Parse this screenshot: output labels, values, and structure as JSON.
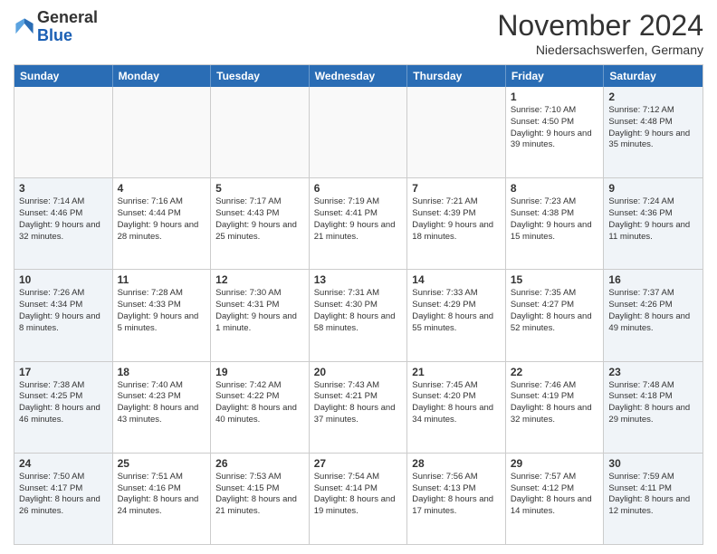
{
  "logo": {
    "line1": "General",
    "line2": "Blue"
  },
  "title": "November 2024",
  "subtitle": "Niedersachswerfen, Germany",
  "header_days": [
    "Sunday",
    "Monday",
    "Tuesday",
    "Wednesday",
    "Thursday",
    "Friday",
    "Saturday"
  ],
  "rows": [
    [
      {
        "day": "",
        "info": "",
        "empty": true
      },
      {
        "day": "",
        "info": "",
        "empty": true
      },
      {
        "day": "",
        "info": "",
        "empty": true
      },
      {
        "day": "",
        "info": "",
        "empty": true
      },
      {
        "day": "",
        "info": "",
        "empty": true
      },
      {
        "day": "1",
        "info": "Sunrise: 7:10 AM\nSunset: 4:50 PM\nDaylight: 9 hours\nand 39 minutes."
      },
      {
        "day": "2",
        "info": "Sunrise: 7:12 AM\nSunset: 4:48 PM\nDaylight: 9 hours\nand 35 minutes.",
        "shaded": true
      }
    ],
    [
      {
        "day": "3",
        "info": "Sunrise: 7:14 AM\nSunset: 4:46 PM\nDaylight: 9 hours\nand 32 minutes.",
        "shaded": true
      },
      {
        "day": "4",
        "info": "Sunrise: 7:16 AM\nSunset: 4:44 PM\nDaylight: 9 hours\nand 28 minutes."
      },
      {
        "day": "5",
        "info": "Sunrise: 7:17 AM\nSunset: 4:43 PM\nDaylight: 9 hours\nand 25 minutes."
      },
      {
        "day": "6",
        "info": "Sunrise: 7:19 AM\nSunset: 4:41 PM\nDaylight: 9 hours\nand 21 minutes."
      },
      {
        "day": "7",
        "info": "Sunrise: 7:21 AM\nSunset: 4:39 PM\nDaylight: 9 hours\nand 18 minutes."
      },
      {
        "day": "8",
        "info": "Sunrise: 7:23 AM\nSunset: 4:38 PM\nDaylight: 9 hours\nand 15 minutes."
      },
      {
        "day": "9",
        "info": "Sunrise: 7:24 AM\nSunset: 4:36 PM\nDaylight: 9 hours\nand 11 minutes.",
        "shaded": true
      }
    ],
    [
      {
        "day": "10",
        "info": "Sunrise: 7:26 AM\nSunset: 4:34 PM\nDaylight: 9 hours\nand 8 minutes.",
        "shaded": true
      },
      {
        "day": "11",
        "info": "Sunrise: 7:28 AM\nSunset: 4:33 PM\nDaylight: 9 hours\nand 5 minutes."
      },
      {
        "day": "12",
        "info": "Sunrise: 7:30 AM\nSunset: 4:31 PM\nDaylight: 9 hours\nand 1 minute."
      },
      {
        "day": "13",
        "info": "Sunrise: 7:31 AM\nSunset: 4:30 PM\nDaylight: 8 hours\nand 58 minutes."
      },
      {
        "day": "14",
        "info": "Sunrise: 7:33 AM\nSunset: 4:29 PM\nDaylight: 8 hours\nand 55 minutes."
      },
      {
        "day": "15",
        "info": "Sunrise: 7:35 AM\nSunset: 4:27 PM\nDaylight: 8 hours\nand 52 minutes."
      },
      {
        "day": "16",
        "info": "Sunrise: 7:37 AM\nSunset: 4:26 PM\nDaylight: 8 hours\nand 49 minutes.",
        "shaded": true
      }
    ],
    [
      {
        "day": "17",
        "info": "Sunrise: 7:38 AM\nSunset: 4:25 PM\nDaylight: 8 hours\nand 46 minutes.",
        "shaded": true
      },
      {
        "day": "18",
        "info": "Sunrise: 7:40 AM\nSunset: 4:23 PM\nDaylight: 8 hours\nand 43 minutes."
      },
      {
        "day": "19",
        "info": "Sunrise: 7:42 AM\nSunset: 4:22 PM\nDaylight: 8 hours\nand 40 minutes."
      },
      {
        "day": "20",
        "info": "Sunrise: 7:43 AM\nSunset: 4:21 PM\nDaylight: 8 hours\nand 37 minutes."
      },
      {
        "day": "21",
        "info": "Sunrise: 7:45 AM\nSunset: 4:20 PM\nDaylight: 8 hours\nand 34 minutes."
      },
      {
        "day": "22",
        "info": "Sunrise: 7:46 AM\nSunset: 4:19 PM\nDaylight: 8 hours\nand 32 minutes."
      },
      {
        "day": "23",
        "info": "Sunrise: 7:48 AM\nSunset: 4:18 PM\nDaylight: 8 hours\nand 29 minutes.",
        "shaded": true
      }
    ],
    [
      {
        "day": "24",
        "info": "Sunrise: 7:50 AM\nSunset: 4:17 PM\nDaylight: 8 hours\nand 26 minutes.",
        "shaded": true
      },
      {
        "day": "25",
        "info": "Sunrise: 7:51 AM\nSunset: 4:16 PM\nDaylight: 8 hours\nand 24 minutes."
      },
      {
        "day": "26",
        "info": "Sunrise: 7:53 AM\nSunset: 4:15 PM\nDaylight: 8 hours\nand 21 minutes."
      },
      {
        "day": "27",
        "info": "Sunrise: 7:54 AM\nSunset: 4:14 PM\nDaylight: 8 hours\nand 19 minutes."
      },
      {
        "day": "28",
        "info": "Sunrise: 7:56 AM\nSunset: 4:13 PM\nDaylight: 8 hours\nand 17 minutes."
      },
      {
        "day": "29",
        "info": "Sunrise: 7:57 AM\nSunset: 4:12 PM\nDaylight: 8 hours\nand 14 minutes."
      },
      {
        "day": "30",
        "info": "Sunrise: 7:59 AM\nSunset: 4:11 PM\nDaylight: 8 hours\nand 12 minutes.",
        "shaded": true
      }
    ]
  ]
}
